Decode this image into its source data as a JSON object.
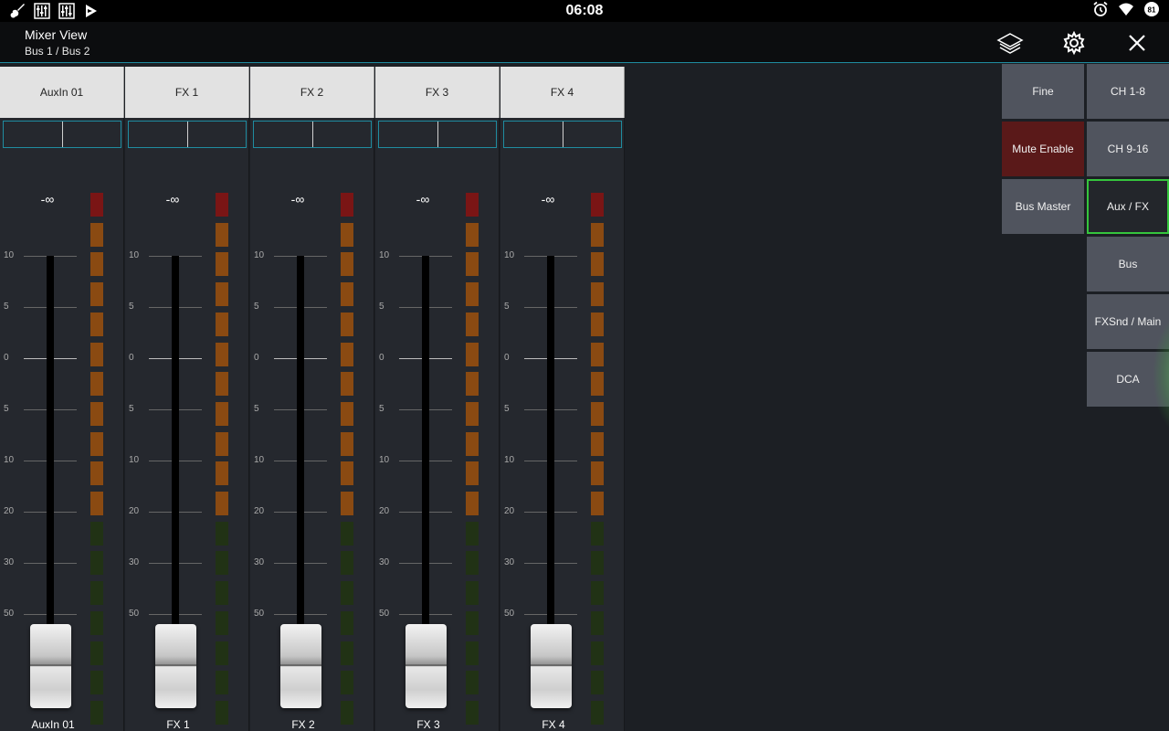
{
  "statusbar": {
    "time": "06:08",
    "left_icons": [
      "guitar-icon",
      "mixer-app-icon",
      "mixer-app-icon",
      "play-store-icon"
    ],
    "right_icons": [
      "alarm-icon",
      "wifi-icon",
      "battery-icon"
    ],
    "battery_level": "81"
  },
  "header": {
    "title": "Mixer View",
    "subtitle": "Bus 1 / Bus 2",
    "icons": [
      "layers-icon",
      "gear-icon",
      "close-icon"
    ]
  },
  "scale_labels": [
    "10",
    "5",
    "0",
    "5",
    "10",
    "20",
    "30",
    "50"
  ],
  "channels": [
    {
      "name": "AuxIn 01",
      "level": "-∞",
      "footer": "AuxIn 01"
    },
    {
      "name": "FX 1",
      "level": "-∞",
      "footer": "FX 1"
    },
    {
      "name": "FX 2",
      "level": "-∞",
      "footer": "FX 2"
    },
    {
      "name": "FX 3",
      "level": "-∞",
      "footer": "FX 3"
    },
    {
      "name": "FX 4",
      "level": "-∞",
      "footer": "FX 4"
    }
  ],
  "meter_colors": {
    "clip": "#7a1515",
    "hot": "#8a4a12",
    "normal": "#213215"
  },
  "right_panel": {
    "left_column": [
      {
        "label": "Fine",
        "state": "normal"
      },
      {
        "label": "Mute Enable",
        "state": "mute"
      },
      {
        "label": "Bus Master",
        "state": "normal"
      }
    ],
    "right_column": [
      {
        "label": "CH 1-8",
        "state": "normal"
      },
      {
        "label": "CH 9-16",
        "state": "normal"
      },
      {
        "label": "Aux / FX",
        "state": "active"
      },
      {
        "label": "Bus",
        "state": "normal"
      },
      {
        "label": "FXSnd / Main",
        "state": "normal"
      },
      {
        "label": "DCA",
        "state": "normal"
      }
    ],
    "active_color": "#35c53d"
  }
}
